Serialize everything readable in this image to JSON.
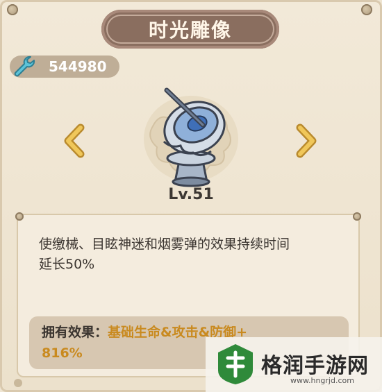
{
  "header": {
    "title": "时光雕像"
  },
  "currency": {
    "icon": "wrench-icon",
    "value": "544980"
  },
  "artifact": {
    "icon": "sundial-statue-icon",
    "level": "Lv.51"
  },
  "description": {
    "text_line1": "使缴械、目眩神迷和烟雾弹的效果持续时间",
    "text_line2": "延长50%"
  },
  "effect": {
    "label": "拥有效果：",
    "value_line1": "基础生命&攻击&防御+",
    "value_line2": "816%"
  },
  "watermark": {
    "name": "格润手游网",
    "url": "www.hngrjd.com"
  },
  "colors": {
    "accent_gold": "#c98a1f",
    "title_plate": "#8a6e5f",
    "arrow": "#e7b94c"
  }
}
